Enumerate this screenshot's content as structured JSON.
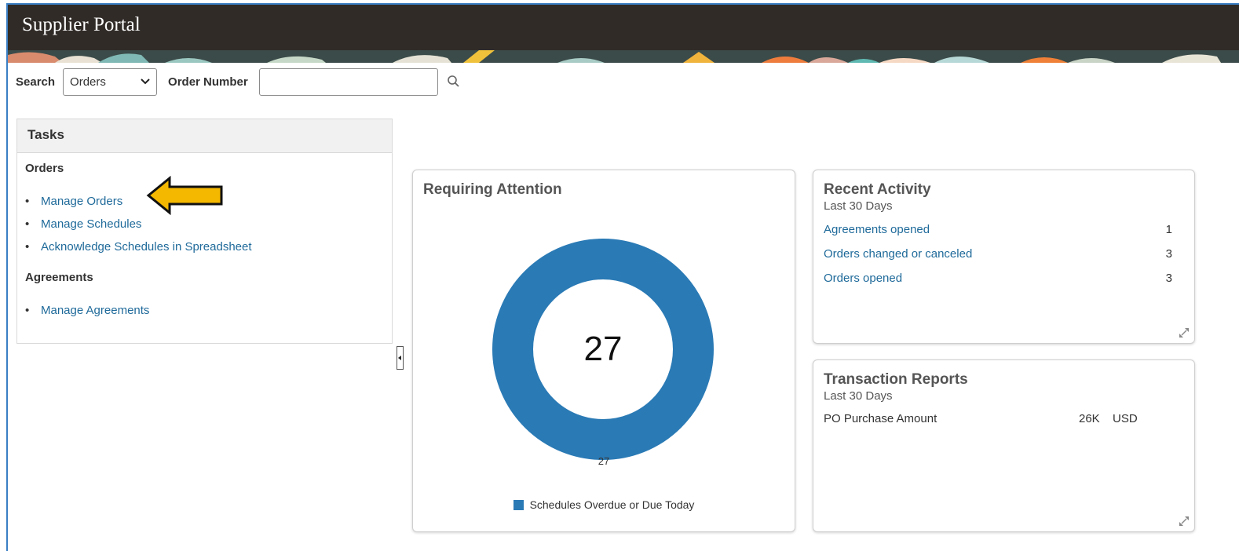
{
  "app": {
    "title": "Supplier Portal"
  },
  "search": {
    "label": "Search",
    "selected": "Orders",
    "field_label": "Order Number",
    "value": ""
  },
  "tasks": {
    "header": "Tasks",
    "sections": [
      {
        "title": "Orders",
        "items": [
          "Manage Orders",
          "Manage Schedules",
          "Acknowledge Schedules in Spreadsheet"
        ]
      },
      {
        "title": "Agreements",
        "items": [
          "Manage Agreements"
        ]
      }
    ]
  },
  "requiring_attention": {
    "title": "Requiring Attention",
    "total": "27",
    "value_label": "27",
    "legend": "Schedules Overdue or Due Today",
    "color": "#2a7ab5"
  },
  "recent_activity": {
    "title": "Recent Activity",
    "subtitle": "Last 30 Days",
    "rows": [
      {
        "label": "Agreements opened",
        "count": "1"
      },
      {
        "label": "Orders changed or canceled",
        "count": "3"
      },
      {
        "label": "Orders opened",
        "count": "3"
      }
    ]
  },
  "transaction_reports": {
    "title": "Transaction Reports",
    "subtitle": "Last 30 Days",
    "rows": [
      {
        "label": "PO Purchase Amount",
        "amount": "26K",
        "currency": "USD"
      }
    ]
  },
  "colors": {
    "link": "#1f6a9a",
    "header": "#302b27",
    "accent": "#2a7ab5",
    "callout_arrow": "#f5b800"
  },
  "icons": {
    "search": "magnifier-icon",
    "expand": "expand-icon",
    "collapse": "collapse-left-icon",
    "select": "chevron-down-icon",
    "callout": "arrow-left-icon"
  }
}
